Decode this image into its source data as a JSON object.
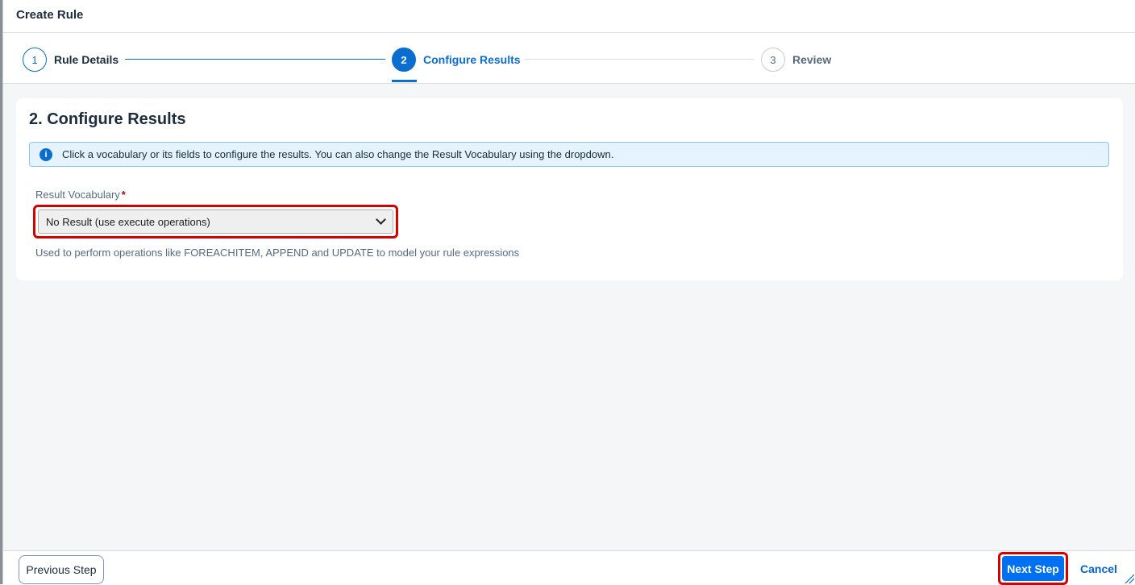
{
  "dialog": {
    "title": "Create Rule"
  },
  "wizard": {
    "steps": [
      {
        "number": "1",
        "label": "Rule Details",
        "state": "completed"
      },
      {
        "number": "2",
        "label": "Configure Results",
        "state": "active"
      },
      {
        "number": "3",
        "label": "Review",
        "state": "future"
      }
    ]
  },
  "section": {
    "title": "2. Configure Results",
    "info_message": "Click a vocabulary or its fields to configure the results. You can also change the Result Vocabulary using the dropdown.",
    "info_icon": "info-icon",
    "field_label": "Result Vocabulary",
    "required_marker": "*",
    "select_value": "No Result (use execute operations)",
    "hint": "Used to perform operations like FOREACHITEM, APPEND and UPDATE to model your rule expressions"
  },
  "footer": {
    "previous_label": "Previous Step",
    "next_label": "Next Step",
    "cancel_label": "Cancel"
  },
  "colors": {
    "accent": "#0a6ed1",
    "primary_button": "#0070f2",
    "highlight": "#d50000",
    "info_background": "#e5f3fe"
  }
}
